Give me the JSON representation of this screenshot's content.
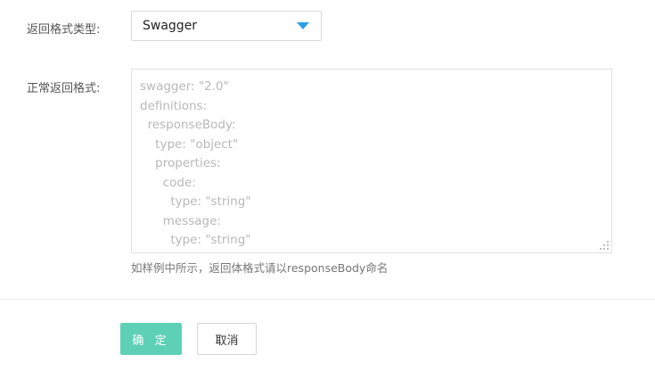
{
  "form": {
    "format_type_label": "返回格式类型:",
    "format_type_select": {
      "value": "Swagger",
      "accent_color": "#2d9ee8"
    },
    "normal_format_label": "正常返回格式:",
    "normal_format_textarea": {
      "placeholder_lines": [
        "swagger: \"2.0\"",
        "definitions:",
        "  responseBody:",
        "    type: \"object\"",
        "    properties:",
        "      code:",
        "        type: \"string\"",
        "      message:",
        "        type: \"string\""
      ]
    },
    "hint": "如样例中所示，返回体格式请以responseBody命名"
  },
  "actions": {
    "confirm_label": "确 定",
    "cancel_label": "取消",
    "confirm_color": "#5ed0b6"
  }
}
